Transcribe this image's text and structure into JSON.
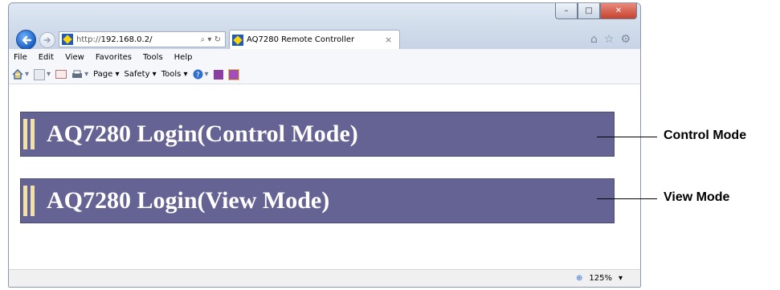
{
  "browser": {
    "address_url_prefix": "http://",
    "address_url_host": "192.168.0.2/",
    "address_tools": "⌕ ▾ ↻",
    "tab_title": "AQ7280 Remote Controller",
    "tab_close": "×",
    "window_buttons": [
      "–",
      "□",
      "✕"
    ],
    "right_icons": [
      "home-icon",
      "star-icon",
      "gear-icon"
    ]
  },
  "menubar": [
    "File",
    "Edit",
    "View",
    "Favorites",
    "Tools",
    "Help"
  ],
  "commandbar": {
    "page": "Page ▾",
    "safety": "Safety ▾",
    "tools": "Tools ▾"
  },
  "banners": [
    {
      "title": "AQ7280 Login(Control Mode)"
    },
    {
      "title": "AQ7280 Login(View Mode)"
    }
  ],
  "annotations": {
    "control": "Control Mode",
    "view": "View Mode"
  },
  "status": {
    "zoom": "125%"
  },
  "colors": {
    "banner_bg": "#656393",
    "banner_bar": "#f2e2a9"
  }
}
